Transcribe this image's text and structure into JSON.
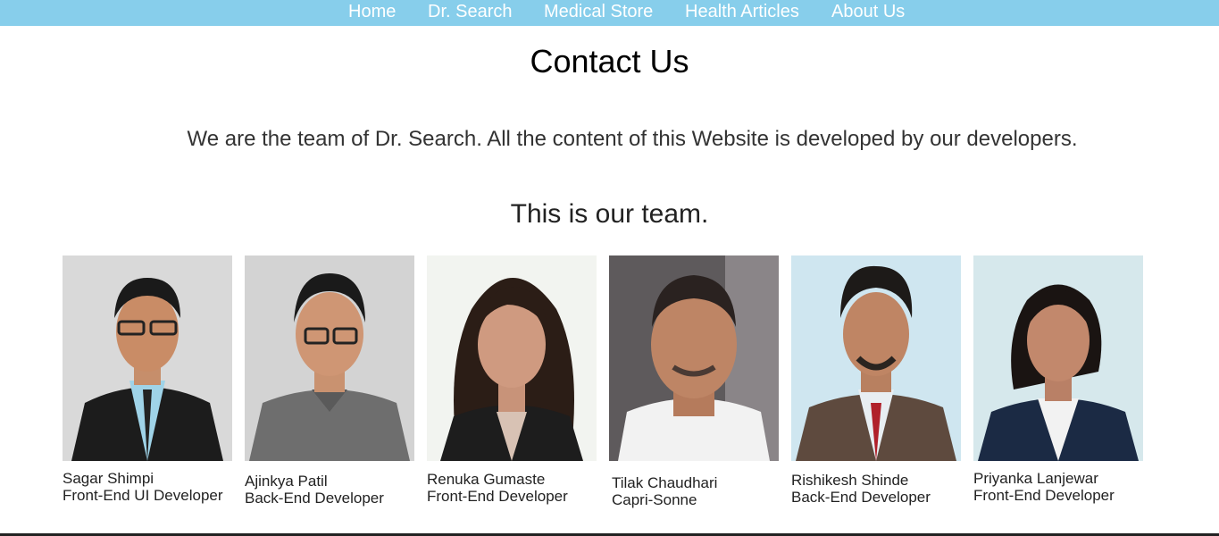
{
  "nav": {
    "items": [
      {
        "label": "Home"
      },
      {
        "label": "Dr. Search"
      },
      {
        "label": "Medical Store"
      },
      {
        "label": "Health Articles"
      },
      {
        "label": "About Us"
      }
    ]
  },
  "page": {
    "title": "Contact Us",
    "intro": "We are the team of Dr. Search. All the content of this Website is developed by our developers.",
    "team_heading": "This is our team."
  },
  "team": [
    {
      "name": "Sagar Shimpi",
      "role": "Front-End UI Developer"
    },
    {
      "name": "Ajinkya Patil",
      "role": "Back-End Developer"
    },
    {
      "name": "Renuka Gumaste",
      "role": "Front-End Developer"
    },
    {
      "name": "Tilak Chaudhari",
      "role": "Capri-Sonne"
    },
    {
      "name": "Rishikesh Shinde",
      "role": "Back-End Developer"
    },
    {
      "name": "Priyanka Lanjewar",
      "role": "Front-End Developer"
    }
  ],
  "colors": {
    "nav_background": "#87ceeb",
    "nav_text": "#ffffff"
  }
}
